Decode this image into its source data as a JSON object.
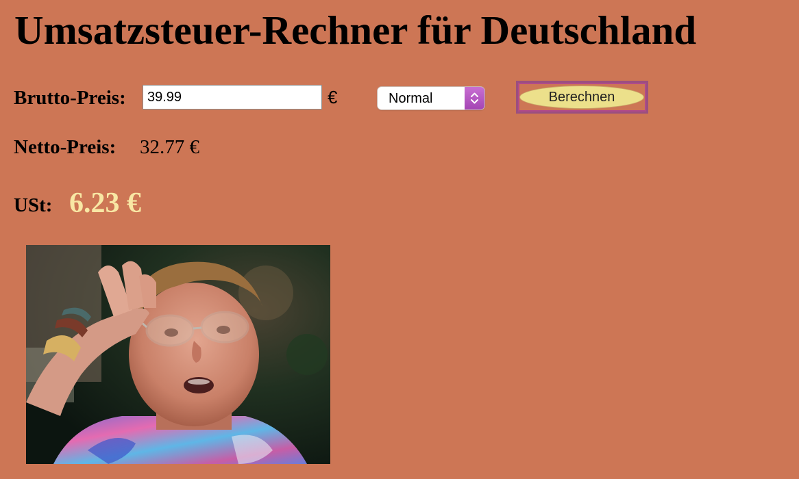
{
  "page": {
    "title": "Umsatzsteuer-Rechner für Deutschland"
  },
  "form": {
    "brutto_label": "Brutto-Preis:",
    "brutto_value": "39.99",
    "currency_symbol": "€",
    "rate_select": {
      "selected": "Normal"
    },
    "submit_label": "Berechnen"
  },
  "results": {
    "netto_label": "Netto-Preis:",
    "netto_value": "32.77 €",
    "ust_label": "USt:",
    "ust_value": "6.23 €"
  },
  "colors": {
    "background": "#cd7655",
    "ust_value": "#f8e7a4",
    "button_fill": "#ece08b",
    "button_frame": "#9b4f7f",
    "select_arrows": "#b65ac3"
  },
  "image": {
    "icon": "reaction-photo"
  }
}
